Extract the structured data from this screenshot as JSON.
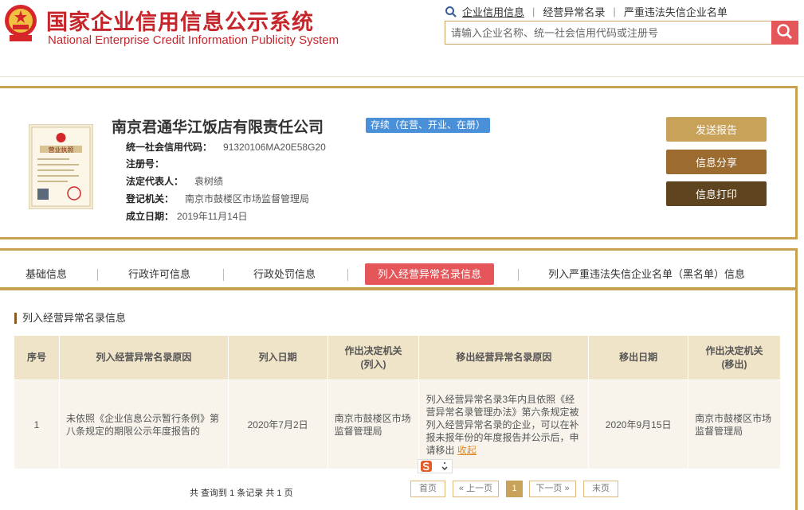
{
  "header": {
    "title_cn": "国家企业信用信息公示系统",
    "title_en": "National Enterprise Credit Information Publicity System",
    "nav_links": [
      "企业信用信息",
      "经营异常名录",
      "严重违法失信企业名单"
    ],
    "search_placeholder": "请输入企业名称、统一社会信用代码或注册号",
    "brand_color": "#c6262b"
  },
  "company": {
    "name": "南京君通华江饭店有限责任公司",
    "status": "存续（在营、开业、在册）",
    "fields": [
      {
        "label": "统一社会信用代码：",
        "value": "91320106MA20E58G20"
      },
      {
        "label": "注册号：",
        "value": ""
      },
      {
        "label": "法定代表人：",
        "value": "袁树绩"
      },
      {
        "label": "登记机关：",
        "value": "南京市鼓楼区市场监督管理局"
      },
      {
        "label": "成立日期：",
        "value": "2019年11月14日"
      }
    ],
    "license_text": "营业执照",
    "buttons": {
      "report": "发送报告",
      "share": "信息分享",
      "print": "信息打印"
    }
  },
  "tabs": [
    "基础信息",
    "行政许可信息",
    "行政处罚信息",
    "列入经营异常名录信息",
    "列入严重违法失信企业名单（黑名单）信息"
  ],
  "active_tab": 3,
  "section_title": "列入经营异常名录信息",
  "table": {
    "headers": [
      "序号",
      "列入经营异常名录原因",
      "列入日期",
      "作出决定机关\n(列入)",
      "移出经营异常名录原因",
      "移出日期",
      "作出决定机关\n(移出)"
    ],
    "rows": [
      {
        "index": "1",
        "reason_in": "未依照《企业信息公示暂行条例》第八条规定的期限公示年度报告的",
        "date_in": "2020年7月2日",
        "authority_in": "南京市鼓楼区市场监督管理局",
        "reason_out": "列入经营异常名录3年内且依照《经营异常名录管理办法》第六条规定被列入经营异常名录的企业，可以在补报未报年份的年度报告并公示后，申请移出",
        "reason_out_link": "收起",
        "date_out": "2020年9月15日",
        "authority_out": "南京市鼓楼区市场监督管理局"
      }
    ]
  },
  "pager": {
    "summary": "共 查询到 1 条记录 共 1 页",
    "first": "首页",
    "prev": "« 上一页",
    "current": "1",
    "next": "下一页 »",
    "last": "末页"
  }
}
